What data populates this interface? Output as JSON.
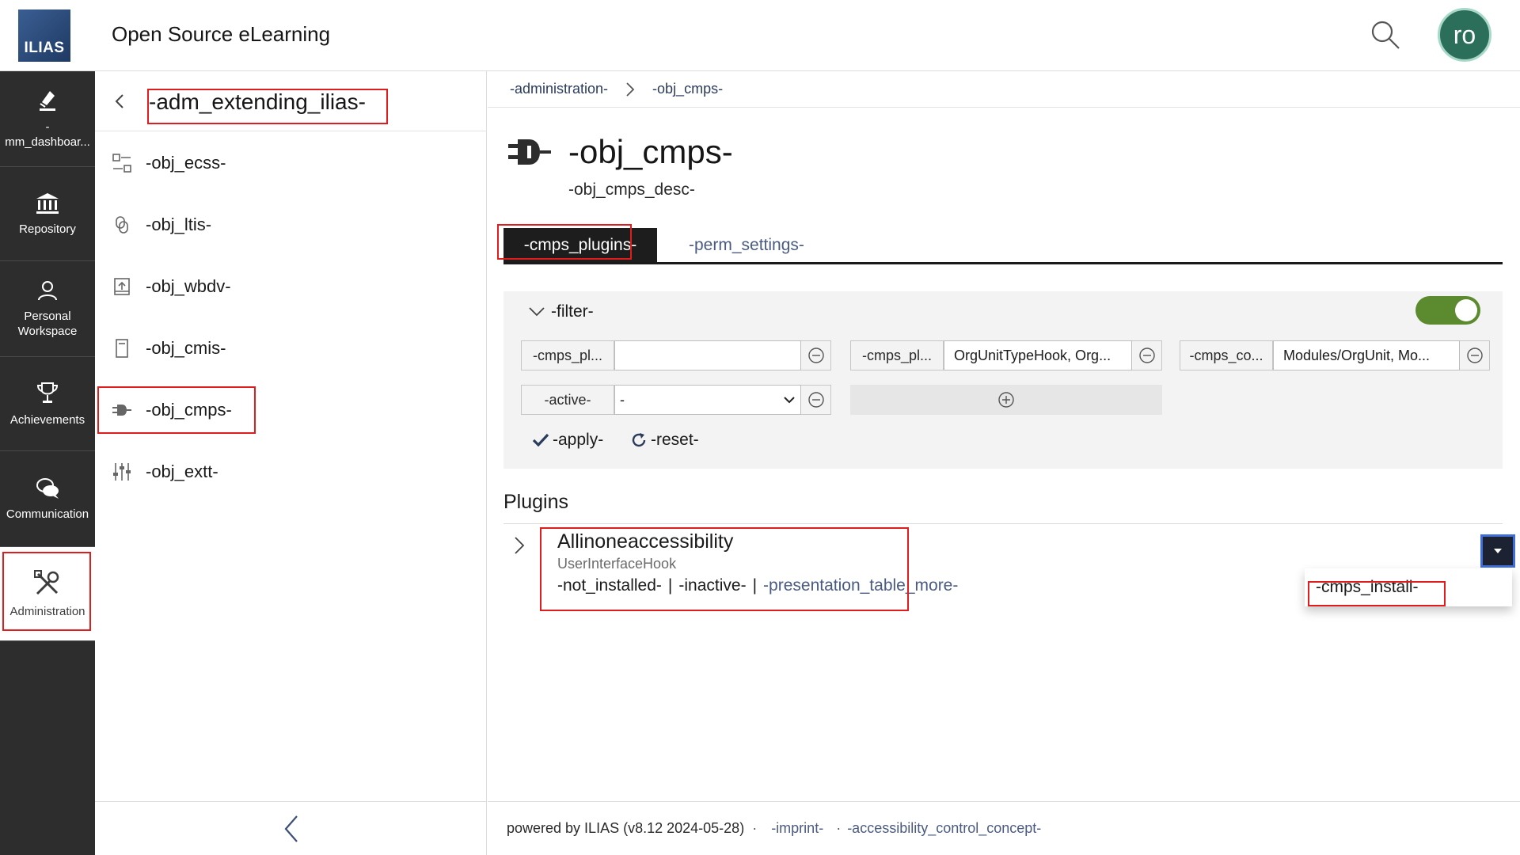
{
  "header": {
    "logo_text": "ILIAS",
    "site_title": "Open Source eLearning",
    "avatar_initials": "ro"
  },
  "mainbar": {
    "items": [
      {
        "label": "-\nmm_dashboar...",
        "icon": "dashboard-icon"
      },
      {
        "label": "Repository",
        "icon": "bank-icon"
      },
      {
        "label": "Personal Workspace",
        "icon": "user-icon"
      },
      {
        "label": "Achievements",
        "icon": "trophy-icon"
      },
      {
        "label": "Communication",
        "icon": "chat-icon"
      },
      {
        "label": "Administration",
        "icon": "tools-icon"
      }
    ]
  },
  "slate": {
    "title": "-adm_extending_ilias-",
    "items": [
      {
        "label": "-obj_ecss-",
        "icon": "ecs-icon"
      },
      {
        "label": "-obj_ltis-",
        "icon": "link-icon"
      },
      {
        "label": "-obj_wbdv-",
        "icon": "upload-icon"
      },
      {
        "label": "-obj_cmis-",
        "icon": "document-icon"
      },
      {
        "label": "-obj_cmps-",
        "icon": "plug-icon"
      },
      {
        "label": "-obj_extt-",
        "icon": "sliders-icon"
      }
    ]
  },
  "breadcrumb": {
    "items": [
      "-administration-",
      "-obj_cmps-"
    ]
  },
  "page": {
    "title": "-obj_cmps-",
    "description": "-obj_cmps_desc-"
  },
  "tabs": {
    "active": "-cmps_plugins-",
    "inactive": "-perm_settings-"
  },
  "filter": {
    "label": "-filter-",
    "toggle_on": true,
    "fields": [
      {
        "label": "-cmps_pl...",
        "value": ""
      },
      {
        "label": "-cmps_pl...",
        "value": "OrgUnitTypeHook, Org..."
      },
      {
        "label": "-cmps_co...",
        "value": "Modules/OrgUnit, Mo..."
      },
      {
        "label": "-active-",
        "value": "-"
      }
    ],
    "apply": "-apply-",
    "reset": "-reset-"
  },
  "section": {
    "title": "Plugins"
  },
  "plugin_row": {
    "title": "Allinoneaccessibility",
    "subtitle": "UserInterfaceHook",
    "status1": "-not_installed-",
    "status2": "-inactive-",
    "more": "-presentation_table_more-",
    "separator": "|"
  },
  "dropdown": {
    "item": "-cmps_install-"
  },
  "footer": {
    "powered": "powered by ILIAS (v8.12 2024-05-28)",
    "imprint": "-imprint-",
    "accessibility": "-accessibility_control_concept-",
    "dot": "·"
  },
  "colors": {
    "mainbar_bg": "#2d2d2d",
    "toggle_on": "#5b8a2f",
    "highlight": "#e01c1c",
    "link": "#4a5a80"
  }
}
